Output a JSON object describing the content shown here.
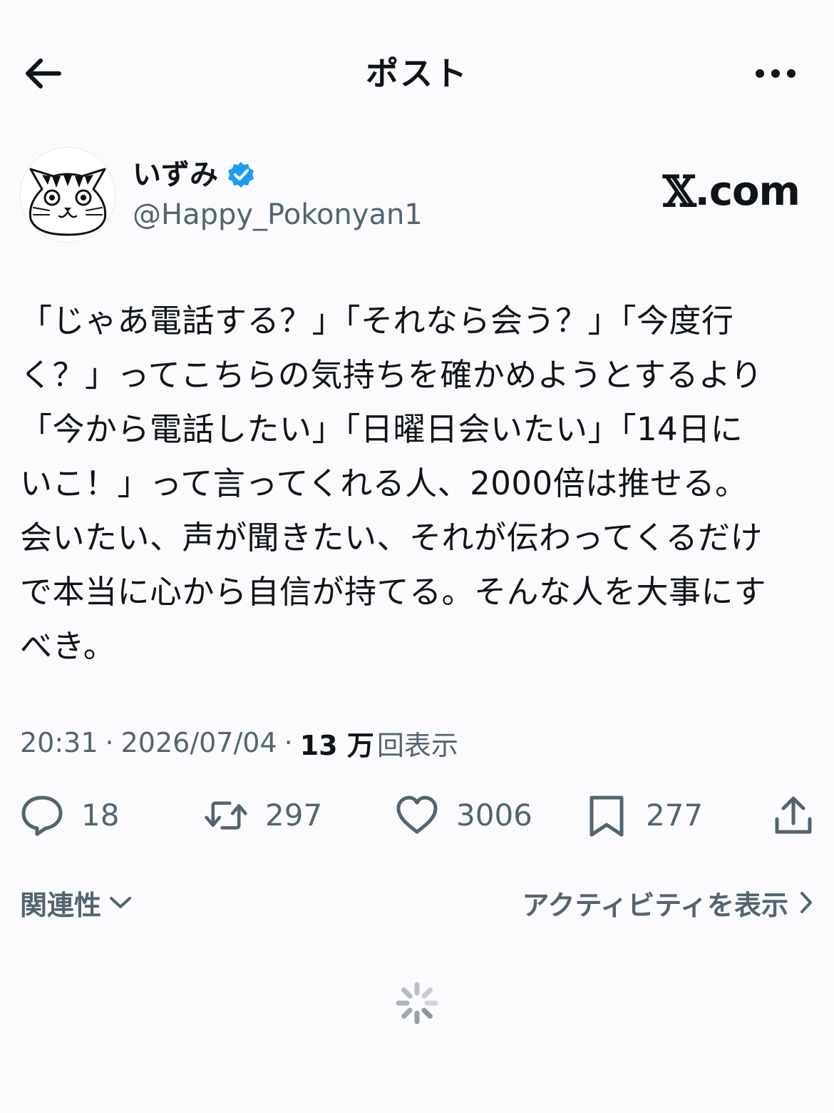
{
  "header": {
    "title": "ポスト",
    "back_icon": "arrow-left-icon",
    "more_icon": "more-horizontal-icon"
  },
  "author": {
    "display_name": "いずみ",
    "handle": "@Happy_Pokonyan1",
    "verified": true,
    "verified_color": "#1d9bf0",
    "avatar_icon": "cat-avatar-icon"
  },
  "brand": {
    "x_mark": "𝕏",
    "suffix": ".com"
  },
  "post": {
    "lines": [
      "「じゃあ電話する？」「それなら会う？」「今度行",
      "く？」ってこちらの気持ちを確かめようとするより",
      "「今から電話したい」「日曜日会いたい」「14日に",
      "いこ！」って言ってくれる人、2000倍は推せる。",
      "会いたい、声が聞きたい、それが伝わってくるだけ",
      "で本当に心から自信が持てる。そんな人を大事にす",
      "べき。"
    ]
  },
  "meta": {
    "time": "20:31",
    "separator": "·",
    "date": "2026/07/04",
    "views_count": "13 万",
    "views_label": "回表示"
  },
  "actions": {
    "reply_count": "18",
    "repost_count": "297",
    "like_count": "3006",
    "bookmark_count": "277",
    "icons": [
      "reply-icon",
      "repost-icon",
      "like-icon",
      "bookmark-icon",
      "share-icon"
    ]
  },
  "footer": {
    "related_label": "関連性",
    "activity_label": "アクティビティを表示"
  },
  "colors": {
    "background": "#fbfbfd",
    "text": "#0f1419",
    "secondary": "#536471"
  }
}
